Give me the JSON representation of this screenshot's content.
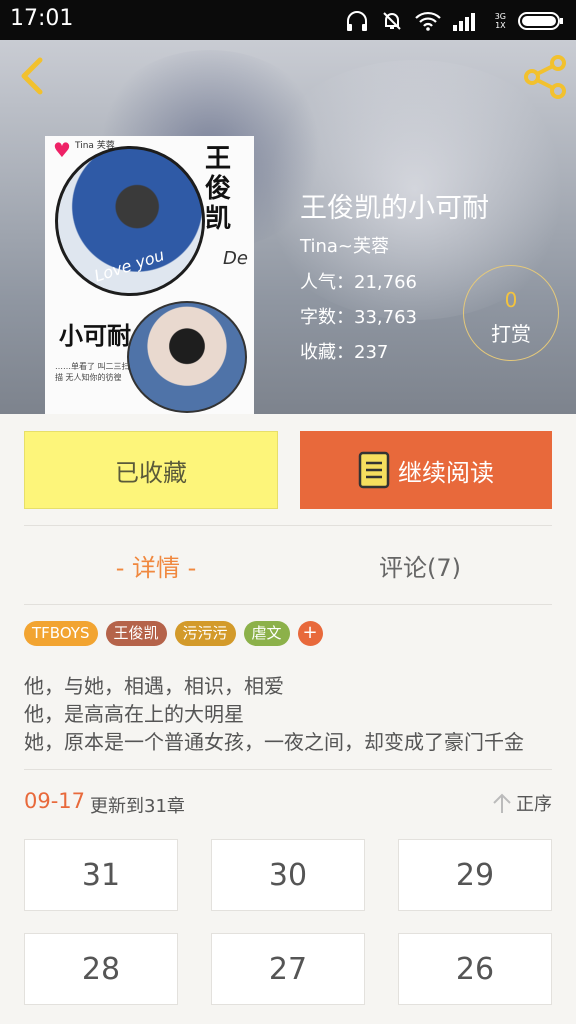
{
  "status": {
    "time": "17:01",
    "network": "3G",
    "network_sub": "1X"
  },
  "book": {
    "title": "王俊凯的小可耐",
    "author": "Tina~芙蓉",
    "popularity": "人气：21,766",
    "word_count": "字数：33,763",
    "favorites": "收藏：237"
  },
  "cover": {
    "name_vertical": "王俊凯",
    "subtitle": "小可耐",
    "love_text": "Love you",
    "de_text": "De",
    "tag_text": "Tina 芙蓉",
    "scribble_text": "……单看了 叫二三扫描 无人知你的彷徨"
  },
  "reward": {
    "value": "0",
    "label": "打赏"
  },
  "actions": {
    "favorite_label": "已收藏",
    "continue_label": "继续阅读"
  },
  "tabs": {
    "detail": "- 详情 -",
    "comments": "评论(7)"
  },
  "tags": [
    {
      "label": "TFBOYS",
      "color": "#f2a431"
    },
    {
      "label": "王俊凯",
      "color": "#b5634a"
    },
    {
      "label": "污污污",
      "color": "#d39a2a"
    },
    {
      "label": "虐文",
      "color": "#8cb14a"
    }
  ],
  "tag_more": "+",
  "description": [
    "他，与她，相遇，相识，相爱",
    "他，是高高在上的大明星",
    "她，原本是一个普通女孩，一夜之间，却变成了豪门千金"
  ],
  "update": {
    "date": "09-17",
    "text": "更新到31章",
    "order_label": "正序"
  },
  "chapters": [
    "31",
    "30",
    "29",
    "28",
    "27",
    "26"
  ],
  "colors": {
    "accent": "#e8693b",
    "favorite_bg": "#fdf57a",
    "tab_active": "#f0883f",
    "reward_ring": "#e5c97a"
  }
}
